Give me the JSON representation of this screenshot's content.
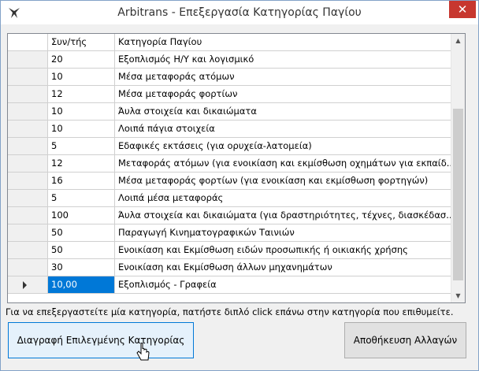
{
  "window": {
    "title": "Arbitrans - Επεξεργασία Κατηγορίας Παγίου",
    "close_glyph": "✕"
  },
  "grid": {
    "columns": [
      "Συν/τής",
      "Κατηγορία Παγίου"
    ],
    "rows": [
      {
        "rate": "20",
        "category": "Εξοπλισμός Η/Υ και λογισμικό"
      },
      {
        "rate": "10",
        "category": "Μέσα μεταφοράς ατόμων"
      },
      {
        "rate": "12",
        "category": "Μέσα μεταφοράς φορτίων"
      },
      {
        "rate": "10",
        "category": "Άυλα στοιχεία και δικαιώματα"
      },
      {
        "rate": "10",
        "category": "Λοιπά πάγια στοιχεία"
      },
      {
        "rate": "5",
        "category": "Εδαφικές εκτάσεις (για ορυχεία-λατομεία)"
      },
      {
        "rate": "12",
        "category": "Μεταφοράς ατόμων (για ενοικίαση και εκμίσθωση οχημάτων για εκπαίδ..."
      },
      {
        "rate": "16",
        "category": "Μέσα μεταφοράς φορτίων (για ενοικίαση και εκμίσθωση φορτηγών)"
      },
      {
        "rate": "5",
        "category": "Λοιπά μέσα μεταφοράς"
      },
      {
        "rate": "100",
        "category": "Άυλα στοιχεία και δικαιώματα (για δραστηριότητες, τέχνες, διασκέδασ..."
      },
      {
        "rate": "50",
        "category": "Παραγωγή Κινηματογραφικών Ταινιών"
      },
      {
        "rate": "50",
        "category": "Ενοικίαση και Εκμίσθωση ειδών προσωπικής ή οικιακής χρήσης"
      },
      {
        "rate": "30",
        "category": "Ενοικίαση και Εκμίσθωση άλλων μηχανημάτων"
      },
      {
        "rate": "10,00",
        "category": "Εξοπλισμός - Γραφεία"
      }
    ],
    "selected_row_index": 13
  },
  "hint": "Για να επεξεργαστείτε μία κατηγορία, πατήστε διπλό click επάνω στην κατηγορία που επιθυμείτε.",
  "buttons": {
    "delete_label": "Διαγραφή Επιλεγμένης Κατηγορίας",
    "save_label": "Αποθήκευση Αλλαγών"
  },
  "colors": {
    "selection": "#0078d7",
    "close": "#c7372f"
  }
}
